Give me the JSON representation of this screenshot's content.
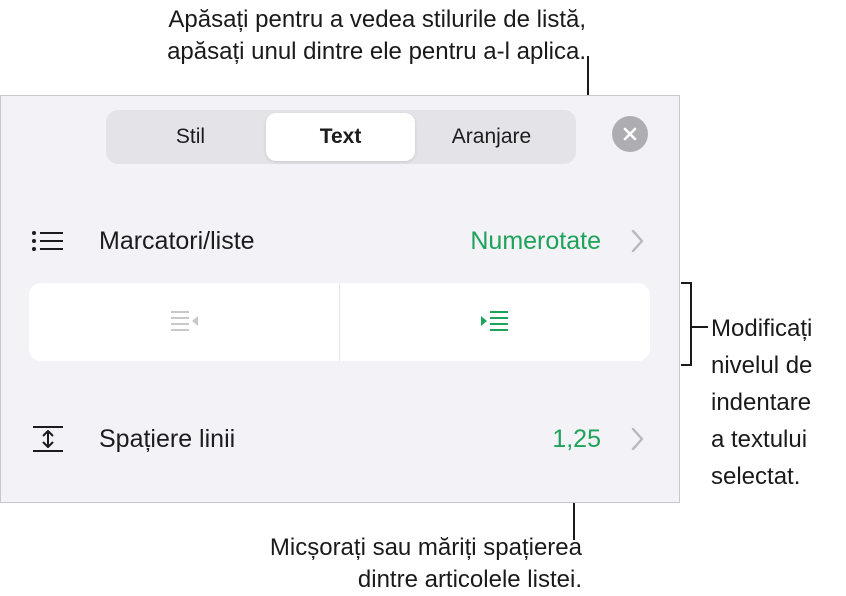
{
  "callouts": {
    "top_line1": "Apăsați pentru a vedea stilurile de listă,",
    "top_line2": "apăsați unul dintre ele pentru a-l aplica.",
    "side_line1": "Modificați",
    "side_line2": "nivelul de",
    "side_line3": "indentare",
    "side_line4": "a textului",
    "side_line5": "selectat.",
    "bottom_line1": "Micșorați sau măriți spațierea",
    "bottom_line2": "dintre articolele listei."
  },
  "tabs": [
    {
      "label": "Stil",
      "active": false
    },
    {
      "label": "Text",
      "active": true
    },
    {
      "label": "Aranjare",
      "active": false
    }
  ],
  "close_icon": "close-icon",
  "bullets_row": {
    "icon": "list-bullets-icon",
    "label": "Marcatori/liste",
    "value": "Numerotate"
  },
  "indent": {
    "decrease_icon": "decrease-indent-icon",
    "increase_icon": "increase-indent-icon",
    "decrease_enabled": false,
    "increase_enabled": true
  },
  "spacing_row": {
    "icon": "line-spacing-icon",
    "label": "Spațiere linii",
    "value": "1,25"
  },
  "colors": {
    "accent_green": "#1ea35a",
    "panel_bg": "#f2f2f7",
    "disabled_gray": "#b8b8bd"
  }
}
